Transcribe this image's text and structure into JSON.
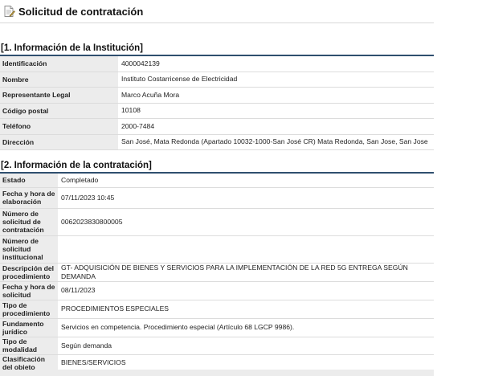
{
  "page": {
    "title": "Solicitud de contratación",
    "icon": "document-form-icon"
  },
  "section1": {
    "heading": "[1. Información de la Institución]",
    "rows": [
      {
        "label": "Identificación",
        "value": "4000042139"
      },
      {
        "label": "Nombre",
        "value": "Instituto Costarricense de Electricidad"
      },
      {
        "label": "Representante Legal",
        "value": "Marco Acuña Mora"
      },
      {
        "label": "Código postal",
        "value": "10108"
      },
      {
        "label": "Teléfono",
        "value": "2000-7484"
      },
      {
        "label": "Dirección",
        "value": "San José, Mata Redonda (Apartado 10032-1000-San José CR) Mata Redonda, San Jose, San Jose"
      }
    ]
  },
  "section2": {
    "heading": "[2. Información de la contratación]",
    "rows": [
      {
        "label": "Estado",
        "value": "Completado"
      },
      {
        "label": "Fecha y hora de elaboración",
        "value": "07/11/2023 10:45"
      },
      {
        "label": "Número de solicitud de contratación",
        "value": "0062023830800005"
      },
      {
        "label": "Número de solicitud institucional",
        "value": ""
      },
      {
        "label": "Descripción del procedimiento",
        "value": "GT- ADQUISICIÓN DE BIENES Y SERVICIOS PARA LA IMPLEMENTACIÓN DE LA RED 5G ENTREGA SEGÚN DEMANDA"
      },
      {
        "label": "Fecha y hora de solicitud",
        "value": "08/11/2023"
      },
      {
        "label": "Tipo de procedimiento",
        "value": "PROCEDIMIENTOS ESPECIALES"
      },
      {
        "label": "Fundamento jurídico",
        "value": "Servicios en competencia. Procedimiento especial (Artículo 68 LGCP 9986)."
      },
      {
        "label": "Tipo de modalidad",
        "value": "Según demanda"
      },
      {
        "label": "Clasificación del objeto",
        "value": "BIENES/SERVICIOS"
      }
    ]
  },
  "colors": {
    "section_rule": "#2f4f6f",
    "label_bg": "#ececec",
    "row_border": "#dcdcdc"
  }
}
